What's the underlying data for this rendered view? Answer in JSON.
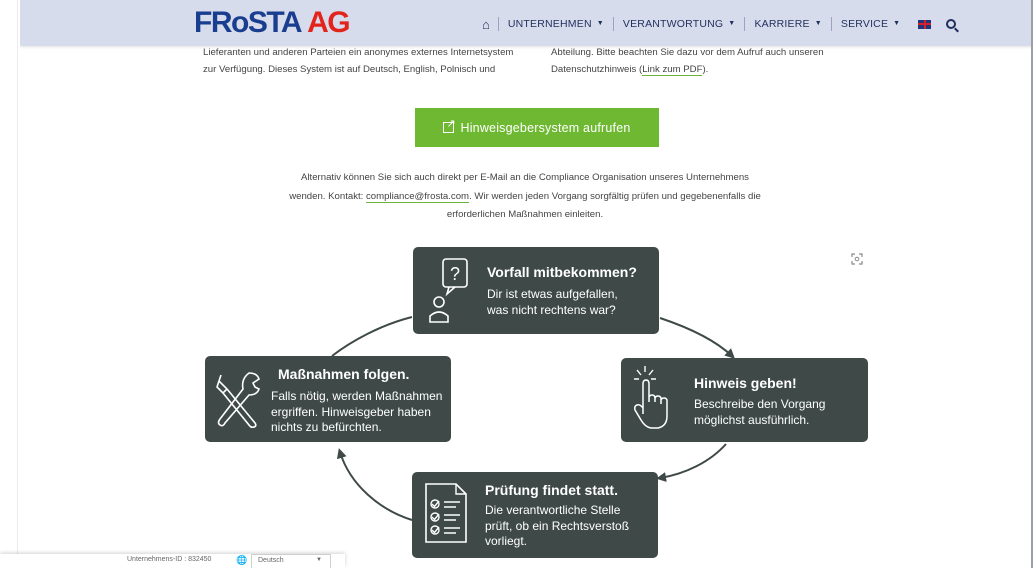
{
  "header": {
    "logo_main": "FRoSTA",
    "logo_ag": "AG",
    "nav": {
      "home_icon": "home-icon",
      "items": [
        {
          "label": "UNTERNEHMEN"
        },
        {
          "label": "VERANTWORTUNG"
        },
        {
          "label": "KARRIERE"
        },
        {
          "label": "SERVICE"
        }
      ],
      "flag_icon": "uk-flag-icon",
      "search_icon": "search-icon"
    }
  },
  "intro": {
    "left_line1": "Lieferanten und anderen Parteien ein anonymes externes Internetsystem",
    "left_line2": "zur Verfügung. Dieses System ist auf Deutsch, English, Polnisch und",
    "right_line1": "Abteilung. Bitte beachten Sie dazu vor dem Aufruf auch unseren",
    "right_line2_pre": "Datenschutzhinweis (",
    "right_link": "Link zum PDF",
    "right_line2_post": ")."
  },
  "cta_button": {
    "label": "Hinweisgebersystem aufrufen",
    "icon": "external-link-icon"
  },
  "alternative": {
    "line1": "Alternativ können Sie sich auch direkt per E-Mail an die Compliance Organisation unseres Unternehmens",
    "line2_pre": "wenden. Kontakt: ",
    "email": "compliance@frosta.com",
    "line2_post": ". Wir werden jeden Vorgang sorgfältig prüfen und gegebenenfalls die",
    "line3": "erforderlichen Maßnahmen einleiten."
  },
  "process": {
    "steps": [
      {
        "title": "Vorfall mitbekommen?",
        "body1": "Dir ist etwas aufgefallen,",
        "body2": "was nicht rechtens war?",
        "icon": "question-person-icon"
      },
      {
        "title": "Hinweis geben!",
        "body1": "Beschreibe den Vorgang",
        "body2": "möglichst ausführlich.",
        "icon": "hand-pointer-icon"
      },
      {
        "title": "Prüfung findet statt.",
        "body1": "Die verantwortliche Stelle",
        "body2": "prüft, ob ein Rechtsverstoß",
        "body3": "vorliegt.",
        "icon": "checklist-icon"
      },
      {
        "title": "Maßnahmen folgen.",
        "body1": "Falls nötig, werden Maßnahmen",
        "body2": "ergriffen. Hinweisgeber haben",
        "body3": "nichts zu befürchten.",
        "icon": "tools-icon"
      }
    ],
    "card_color": "#3f4a48"
  },
  "footer_widget": {
    "company_id": "Unternehmens-ID : 832450",
    "language": "Deutsch"
  },
  "colors": {
    "header_bg": "#d7dcec",
    "brand_blue": "#1a3e8f",
    "brand_red": "#e2241c",
    "button_green": "#6fb832"
  }
}
